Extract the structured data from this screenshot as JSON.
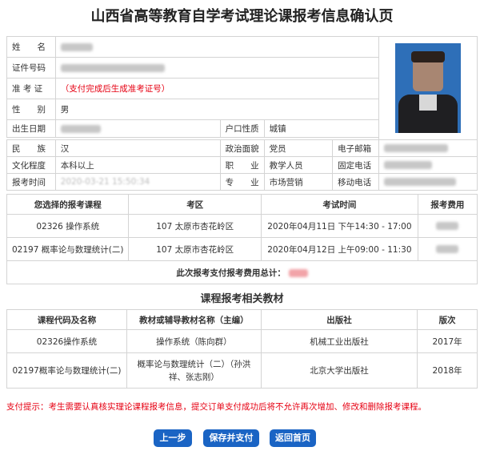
{
  "title": "山西省高等教育自学考试理论课报考信息确认页",
  "person": {
    "name_label": "姓　　名",
    "id_label": "证件号码",
    "ticket_label": "准 考 证",
    "ticket_value": "（支付完成后生成准考证号）",
    "gender_label": "性　　别",
    "gender_value": "男",
    "birth_label": "出生日期",
    "hukou_label": "户口性质",
    "hukou_value": "城镇",
    "ethnic_label": "民　　族",
    "ethnic_value": "汉",
    "politics_label": "政治面貌",
    "politics_value": "党员",
    "email_label": "电子邮箱",
    "edu_label": "文化程度",
    "edu_value": "本科以上",
    "job_label": "职　　业",
    "job_value": "教学人员",
    "tel_label": "固定电话",
    "regtime_label": "报考时间",
    "regtime_value": "2020-03-21 15:50:34",
    "major_label": "专　　业",
    "major_value": "市场营销",
    "mobile_label": "移动电话"
  },
  "exam": {
    "headers": [
      "您选择的报考课程",
      "考区",
      "考试时间",
      "报考费用"
    ],
    "rows": [
      {
        "course": "02326 操作系统",
        "area": "107 太原市杏花岭区",
        "time": "2020年04月11日 下午14:30 - 17:00"
      },
      {
        "course": "02197 概率论与数理统计(二)",
        "area": "107 太原市杏花岭区",
        "time": "2020年04月12日 上午09:00 - 11:30"
      }
    ],
    "total_label": "此次报考支付报考费用总计："
  },
  "textbook": {
    "section_title": "课程报考相关教材",
    "headers": [
      "课程代码及名称",
      "教材或辅导教材名称（主编）",
      "出版社",
      "版次"
    ],
    "rows": [
      {
        "course": "02326操作系统",
        "book": "操作系统（陈向群）",
        "press": "机械工业出版社",
        "edition": "2017年"
      },
      {
        "course": "02197概率论与数理统计(二)",
        "book": "概率论与数理统计（二）（孙洪祥、张志刚）",
        "press": "北京大学出版社",
        "edition": "2018年"
      }
    ]
  },
  "tip": "支付提示：考生需要认真核实理论课程报考信息，提交订单支付成功后将不允许再次增加、修改和删除报考课程。",
  "buttons": {
    "prev": "上一步",
    "save_pay": "保存并支付",
    "home": "返回首页"
  },
  "colors": {
    "accent": "#1a64c4",
    "warning": "#e60012"
  }
}
